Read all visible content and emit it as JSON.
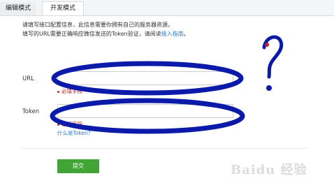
{
  "tabs": [
    {
      "label": "编辑模式"
    },
    {
      "label": "开发模式"
    }
  ],
  "intro": {
    "line1": "请填写接口配置信息，此信息需要你拥有自己的服务器资源。",
    "line2_prefix": "填写的URL需要正确响应微信发送的Token验证，请阅读",
    "line2_link": "接入指南",
    "line2_suffix": "。"
  },
  "form": {
    "url_label": "URL",
    "url_error": "必填字段",
    "token_label": "Token",
    "token_error": "必填字段",
    "token_help": "什么是Token？",
    "submit_label": "提交"
  },
  "annotation": {
    "question_mark": "?",
    "ink_color": "#0b1aa8"
  },
  "watermark": "Baidu 经验"
}
